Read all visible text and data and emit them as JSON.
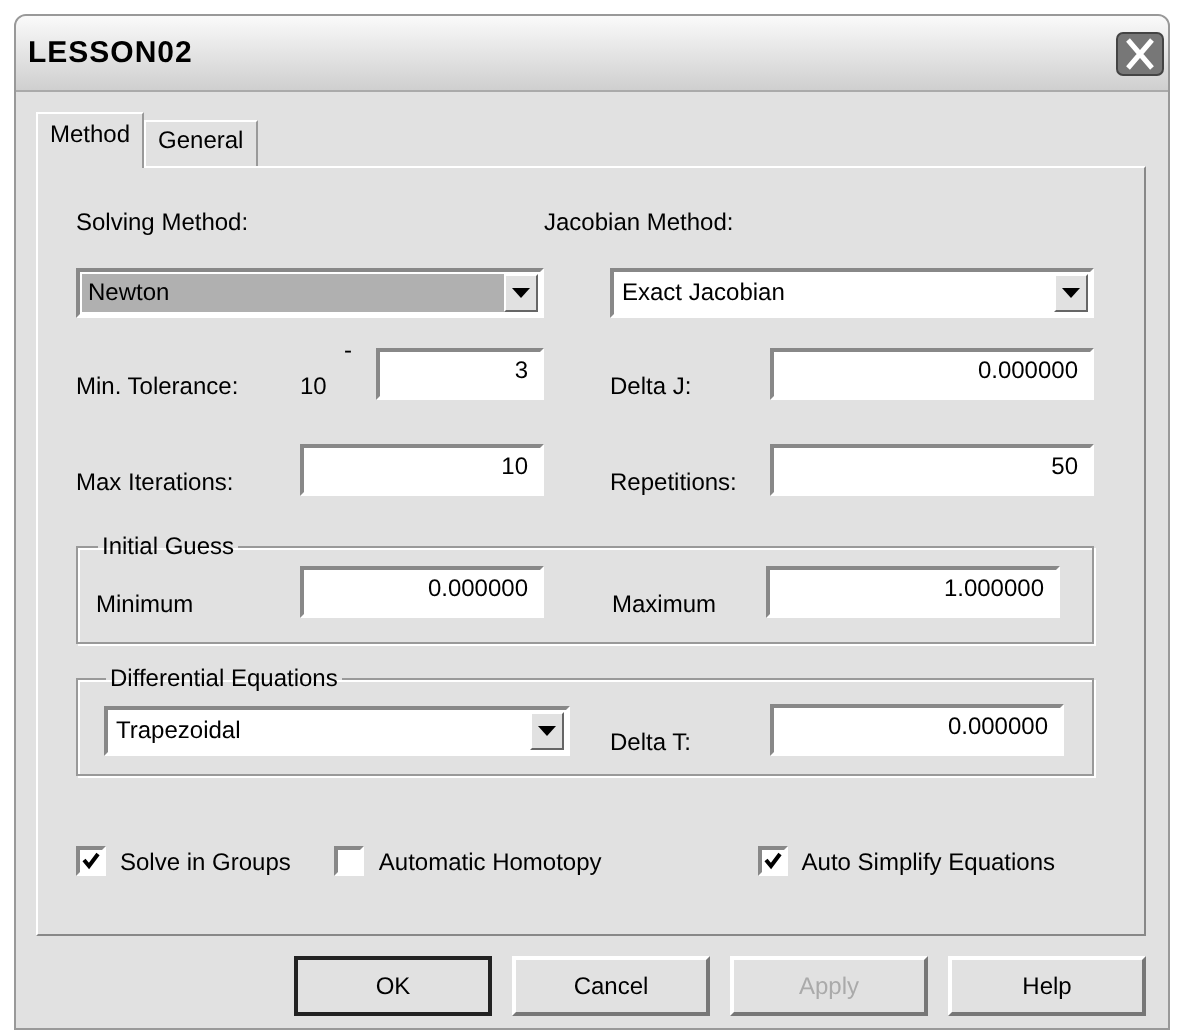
{
  "window": {
    "title": "LESSON02"
  },
  "tabs": [
    {
      "label": "Method",
      "selected": true
    },
    {
      "label": "General",
      "selected": false
    }
  ],
  "solving_method": {
    "label": "Solving Method:",
    "value": "Newton",
    "focused": true
  },
  "jacobian_method": {
    "label": "Jacobian Method:",
    "value": "Exact Jacobian",
    "focused": false
  },
  "min_tolerance": {
    "label": "Min. Tolerance:",
    "base": "10",
    "exponent_sign": "-",
    "value": "3"
  },
  "delta_j": {
    "label": "Delta J:",
    "value": "0.000000"
  },
  "max_iterations": {
    "label": "Max Iterations:",
    "value": "10"
  },
  "repetitions": {
    "label": "Repetitions:",
    "value": "50"
  },
  "initial_guess": {
    "title": "Initial Guess",
    "minimum": {
      "label": "Minimum",
      "value": "0.000000"
    },
    "maximum": {
      "label": "Maximum",
      "value": "1.000000"
    }
  },
  "differential_equations": {
    "title": "Differential Equations",
    "method": {
      "value": "Trapezoidal",
      "focused": false
    },
    "delta_t": {
      "label": "Delta T:",
      "value": "0.000000"
    }
  },
  "options": [
    {
      "label": "Solve in Groups",
      "checked": true
    },
    {
      "label": "Automatic Homotopy",
      "checked": false
    },
    {
      "label": "Auto Simplify Equations",
      "checked": true
    }
  ],
  "buttons": [
    {
      "label": "OK",
      "default": true,
      "disabled": false
    },
    {
      "label": "Cancel",
      "default": false,
      "disabled": false
    },
    {
      "label": "Apply",
      "default": false,
      "disabled": true
    },
    {
      "label": "Help",
      "default": false,
      "disabled": false
    }
  ]
}
